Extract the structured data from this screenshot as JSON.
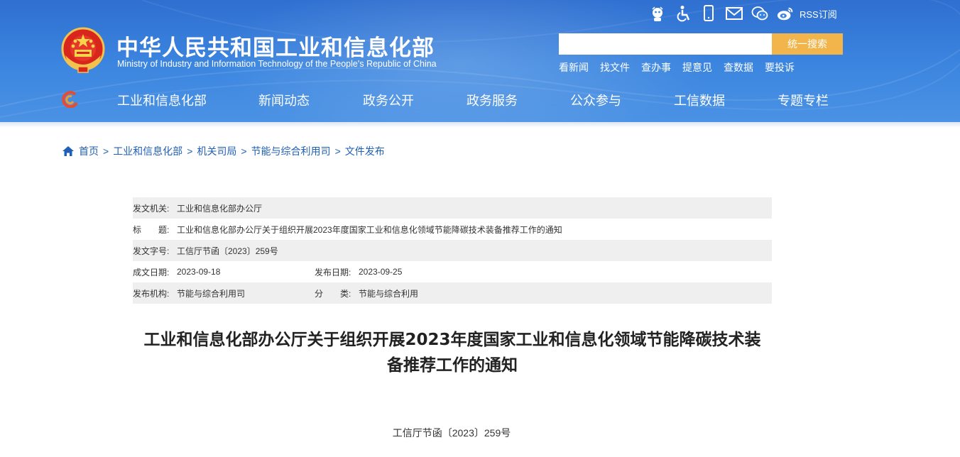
{
  "header": {
    "title": "中华人民共和国工业和信息化部",
    "subtitle": "Ministry of Industry and Information Technology of the People's Republic of China",
    "tools": [
      {
        "icon": "robot-assistant-icon"
      },
      {
        "icon": "accessibility-icon"
      },
      {
        "icon": "mobile-icon"
      },
      {
        "icon": "mail-icon"
      },
      {
        "icon": "wechat-icon"
      },
      {
        "icon": "weibo-icon"
      }
    ],
    "rss_label": "RSS订阅",
    "search": {
      "placeholder": "",
      "button_label": "统一搜索"
    },
    "quick_links": [
      "看新闻",
      "找文件",
      "查办事",
      "提意见",
      "查数据",
      "要投诉"
    ],
    "nav": [
      "工业和信息化部",
      "新闻动态",
      "政务公开",
      "政务服务",
      "公众参与",
      "工信数据",
      "专题专栏"
    ]
  },
  "breadcrumb": [
    "首页",
    "工业和信息化部",
    "机关司局",
    "节能与综合利用司",
    "文件发布"
  ],
  "meta": {
    "issuer_label": "发文机关:",
    "issuer": "工业和信息化部办公厅",
    "title_label": "标　　题:",
    "title": "工业和信息化部办公厅关于组织开展2023年度国家工业和信息化领域节能降碳技术装备推荐工作的通知",
    "doc_no_label": "发文字号:",
    "doc_no": "工信厅节函〔2023〕259号",
    "created_label": "成文日期:",
    "created": "2023-09-18",
    "published_label": "发布日期:",
    "published": "2023-09-25",
    "org_label": "发布机构:",
    "org": "节能与综合利用司",
    "category_label": "分　　类:",
    "category": "节能与综合利用"
  },
  "document": {
    "title_line1": "工业和信息化部办公厅关于组织开展2023年度国家工业和信息化领域节能降碳技术装",
    "title_line2": "备推荐工作的通知",
    "number": "工信厅节函〔2023〕259号"
  },
  "colors": {
    "header_blue": "#3c86e0",
    "search_button": "#f2b54b",
    "link_blue": "#1f5fb5",
    "meta_shade": "#efefef"
  }
}
